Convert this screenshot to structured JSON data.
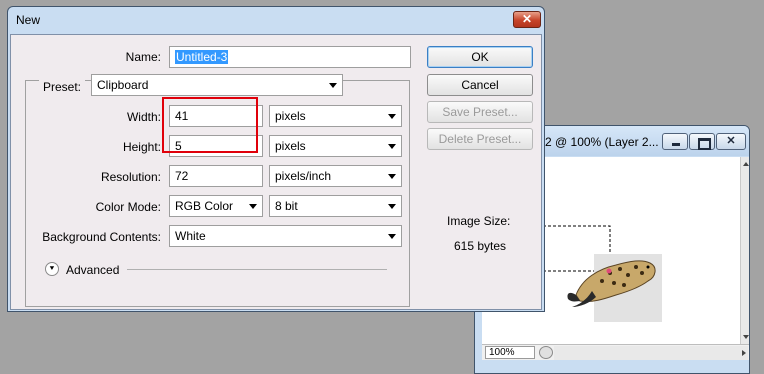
{
  "doc_window": {
    "title": "-2 @ 100% (Layer 2...",
    "zoom": "100%"
  },
  "dialog": {
    "title": "New",
    "close_label": "✕",
    "name": {
      "label": "Name:",
      "value": "Untitled-3"
    },
    "preset": {
      "label": "Preset:",
      "value": "Clipboard"
    },
    "width": {
      "label": "Width:",
      "value": "41",
      "unit": "pixels"
    },
    "height": {
      "label": "Height:",
      "value": "5",
      "unit": "pixels"
    },
    "resolution": {
      "label": "Resolution:",
      "value": "72",
      "unit": "pixels/inch"
    },
    "color_mode": {
      "label": "Color Mode:",
      "value": "RGB Color",
      "depth": "8 bit"
    },
    "background": {
      "label": "Background Contents:",
      "value": "White"
    },
    "advanced": {
      "label": "Advanced",
      "icon": "chevron-double-down-icon"
    },
    "buttons": {
      "ok": "OK",
      "cancel": "Cancel",
      "save_preset": "Save Preset...",
      "delete_preset": "Delete Preset..."
    },
    "image_size": {
      "label": "Image Size:",
      "value": "615 bytes"
    }
  },
  "colors": {
    "highlight_box": "#e0000a",
    "selection": "#3399ff",
    "dialog_bg": "#f0ebee"
  }
}
